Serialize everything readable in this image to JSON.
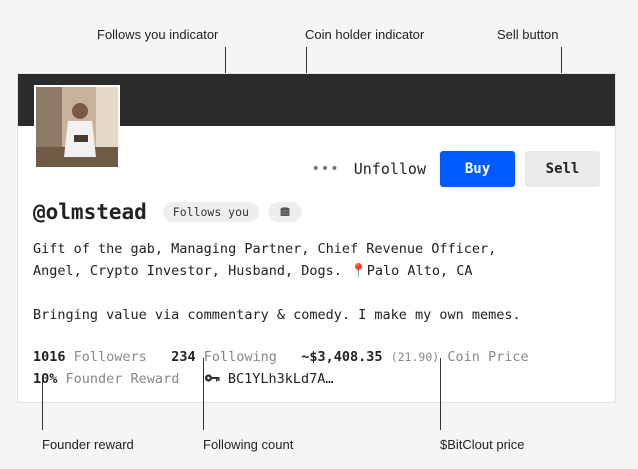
{
  "callouts": {
    "follows_you": "Follows you indicator",
    "coin_holder": "Coin holder indicator",
    "sell_button": "Sell button",
    "founder_reward": "Founder reward",
    "following_count": "Following count",
    "bitclout_price": "$BitClout price"
  },
  "profile": {
    "handle": "@olmstead",
    "follows_you_badge": "Follows you",
    "coin_holder_icon": "coins-icon",
    "bio_line1": "Gift of the gab, Managing Partner, Chief Revenue Officer,",
    "bio_line2_a": "Angel, Crypto Investor, Husband, Dogs. ",
    "bio_line2_pin": "📍",
    "bio_line2_b": "Palo Alto, CA",
    "bio_line3": "Bringing value via commentary & comedy. I make my own memes."
  },
  "actions": {
    "more_label": "•••",
    "unfollow_label": "Unfollow",
    "buy_label": "Buy",
    "sell_label": "Sell"
  },
  "stats": {
    "followers_count": "1016",
    "followers_label": "Followers",
    "following_count": "234",
    "following_label": "Following",
    "coin_price_usd": "~$3,408.35",
    "coin_price_clout": "(21.90)",
    "coin_price_label": "Coin Price",
    "founder_reward_value": "10%",
    "founder_reward_label": "Founder Reward",
    "key_icon": "key-icon",
    "public_key": "BC1YLh3kLd7A…"
  },
  "colors": {
    "banner": "#2b2b2b",
    "buy_button": "#005bff",
    "sell_button": "#eaeaea",
    "muted_text": "#888888"
  }
}
